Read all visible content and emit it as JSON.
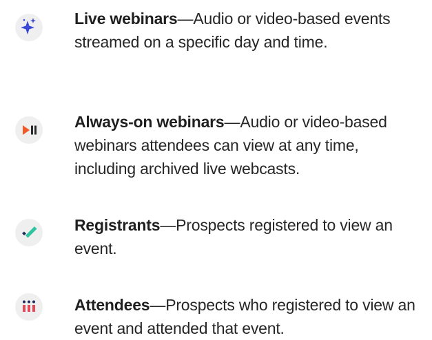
{
  "items": [
    {
      "title": "Live webinars",
      "description": "—Audio or video-based events streamed on a specific day and time.",
      "icon": "sparkle-icon",
      "accent": "#3b49d6"
    },
    {
      "title": "Always-on webinars",
      "description": "—Audio or video-based webinars attendees can view at any time, including archived live webcasts.",
      "icon": "play-pause-icon",
      "accent": "#f05a28"
    },
    {
      "title": "Registrants",
      "description": "—Prospects registered to view an event.",
      "icon": "checkmark-icon",
      "accent": "#2ec4a0"
    },
    {
      "title": "Attendees",
      "description": "—Prospects who registered to view an event and attended that event.",
      "icon": "people-icon",
      "accent": "#e24a5a"
    }
  ]
}
